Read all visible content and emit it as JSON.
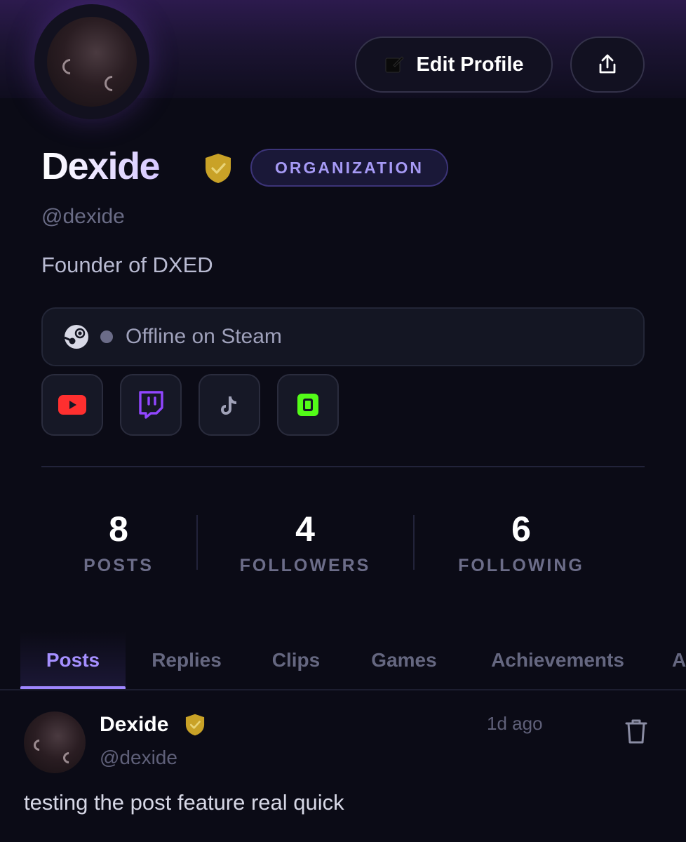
{
  "profile": {
    "name": "Dexide",
    "handle": "@dexide",
    "badge": "ORGANIZATION",
    "bio": "Founder of DXED",
    "verified": true
  },
  "actions": {
    "edit_label": "Edit Profile",
    "edit_icon": "pencil-icon",
    "share_icon": "share-icon"
  },
  "steam": {
    "status": "Offline on Steam",
    "icon": "steam-icon"
  },
  "socials": [
    {
      "name": "youtube",
      "icon": "youtube-icon",
      "color": "#ff2f2f"
    },
    {
      "name": "twitch",
      "icon": "twitch-icon",
      "color": "#9146ff"
    },
    {
      "name": "tiktok",
      "icon": "tiktok-icon",
      "color": "#a0a2b8"
    },
    {
      "name": "kick",
      "icon": "kick-icon",
      "color": "#53fc18"
    }
  ],
  "stats": [
    {
      "value": "8",
      "label": "POSTS"
    },
    {
      "value": "4",
      "label": "FOLLOWERS"
    },
    {
      "value": "6",
      "label": "FOLLOWING"
    }
  ],
  "tabs": [
    {
      "label": "Posts",
      "active": true
    },
    {
      "label": "Replies",
      "active": false
    },
    {
      "label": "Clips",
      "active": false
    },
    {
      "label": "Games",
      "active": false
    },
    {
      "label": "Achievements",
      "active": false
    },
    {
      "label": "A",
      "active": false
    }
  ],
  "post": {
    "author": "Dexide",
    "handle": "@dexide",
    "time": "1d ago",
    "text": "testing the post feature real quick",
    "verified": true
  },
  "colors": {
    "accent": "#a58fff",
    "verified_gold": "#c9a227",
    "background": "#0b0b16"
  }
}
